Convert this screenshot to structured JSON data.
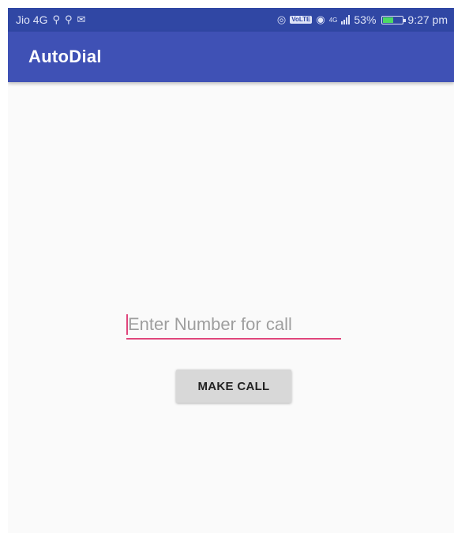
{
  "status_bar": {
    "carrier": "Jio 4G",
    "left_icons": [
      "usb-icon",
      "usb-icon",
      "message-icon"
    ],
    "right_icons": [
      "hotspot-icon",
      "volte-icon",
      "eye-icon",
      "signal-icon"
    ],
    "volte_label": "VoLTE",
    "network_type": "4G",
    "battery_percent": "53%",
    "battery_level": 0.53,
    "time": "9:27 pm"
  },
  "app_bar": {
    "title": "AutoDial"
  },
  "form": {
    "number_placeholder": "Enter Number for call",
    "number_value": "",
    "call_button_label": "MAKE CALL"
  },
  "colors": {
    "status_bar": "#3047a4",
    "app_bar": "#3f51b5",
    "accent": "#e0457b",
    "background": "#fafafa",
    "button": "#d8d8d8"
  }
}
